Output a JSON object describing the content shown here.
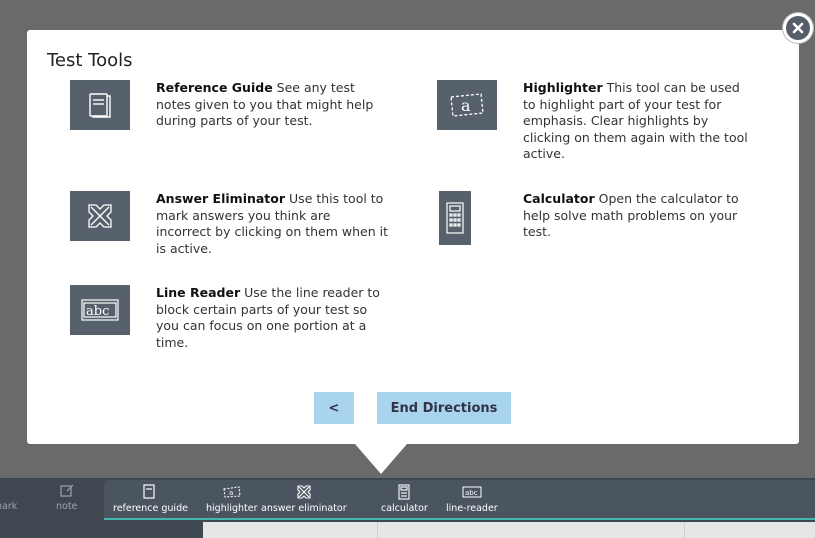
{
  "modal": {
    "title": "Test Tools",
    "tools": [
      {
        "name": "Reference Guide",
        "desc": "See any test notes given to you that might help during parts of your test.",
        "icon": "book-icon"
      },
      {
        "name": "Highlighter",
        "desc": "This tool can be used to highlight part of your test for emphasis. Clear highlights by clicking on them again with the tool active.",
        "icon": "highlighter-icon"
      },
      {
        "name": "Answer Eliminator",
        "desc": "Use this tool to mark answers you think are incorrect by clicking on them when it is active.",
        "icon": "eliminator-icon"
      },
      {
        "name": "Calculator",
        "desc": "Open the calculator to help solve math problems on your test.",
        "icon": "calculator-icon"
      },
      {
        "name": "Line Reader",
        "desc": "Use the line reader to block certain parts of your test so you can focus on one portion at a time.",
        "icon": "line-reader-icon"
      }
    ],
    "back_label": "<",
    "end_label": "End Directions"
  },
  "toolbar": {
    "items": [
      {
        "label": "nark",
        "icon": ""
      },
      {
        "label": "note",
        "icon": "note-icon"
      },
      {
        "label": "reference guide",
        "icon": "book-icon"
      },
      {
        "label": "highlighter",
        "icon": "highlighter-icon"
      },
      {
        "label": "answer eliminator",
        "icon": "eliminator-icon"
      },
      {
        "label": "calculator",
        "icon": "calculator-icon"
      },
      {
        "label": "line-reader",
        "icon": "line-reader-icon"
      }
    ]
  },
  "colors": {
    "icon_bg": "#56616c",
    "button_bg": "#a8d4ee",
    "toolbar_bg": "#3f4851",
    "accent": "#46b5ad"
  }
}
